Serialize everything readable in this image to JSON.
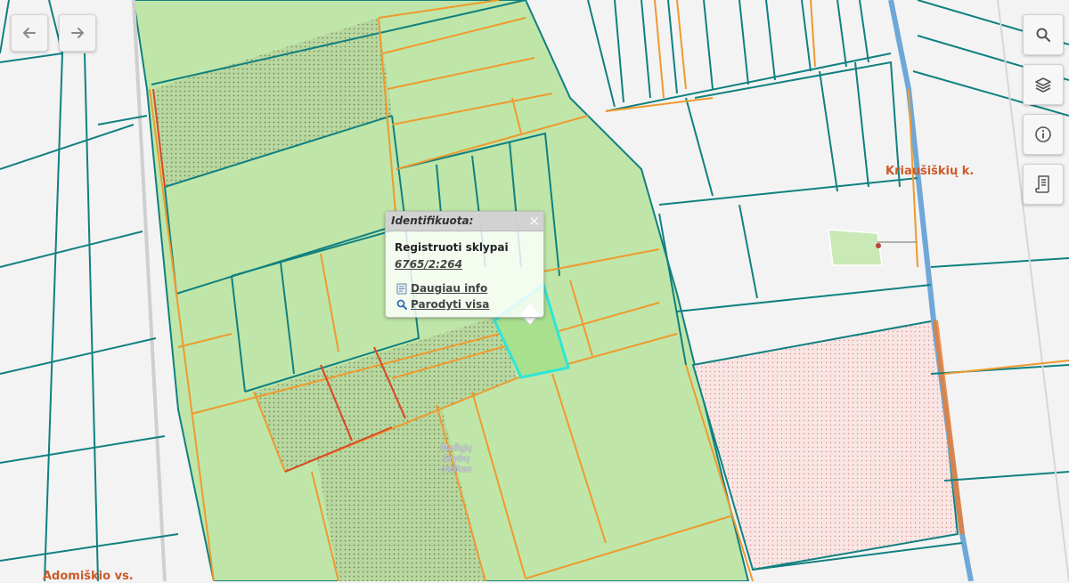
{
  "popup": {
    "title": "Identifikuota:",
    "close_glyph": "×",
    "layer_name": "Registruoti sklypai",
    "parcel_id": "6765/2:264",
    "more_info_label": "Daugiau info",
    "show_all_label": "Parodyti visa"
  },
  "labels": {
    "village": "Kriaušiškių k.",
    "forest": "Mažųjų Grybų miškas",
    "settlement": "Adomiškio vs."
  },
  "toolbar": {
    "back_icon": "arrow-left-icon",
    "forward_icon": "arrow-right-icon",
    "search_icon": "search-icon",
    "layers_icon": "layers-icon",
    "info_icon": "info-icon",
    "legend_icon": "legend-document-icon"
  },
  "colors": {
    "background": "#f2f2f2",
    "forest_fill": "#bfe6a8",
    "parcel_boundary": "#118080",
    "cadastral_boundary": "#ee9a2e",
    "selection": "#2ee6d6",
    "restricted_area": "#f7e3e1",
    "road": "#6fa8d8"
  }
}
